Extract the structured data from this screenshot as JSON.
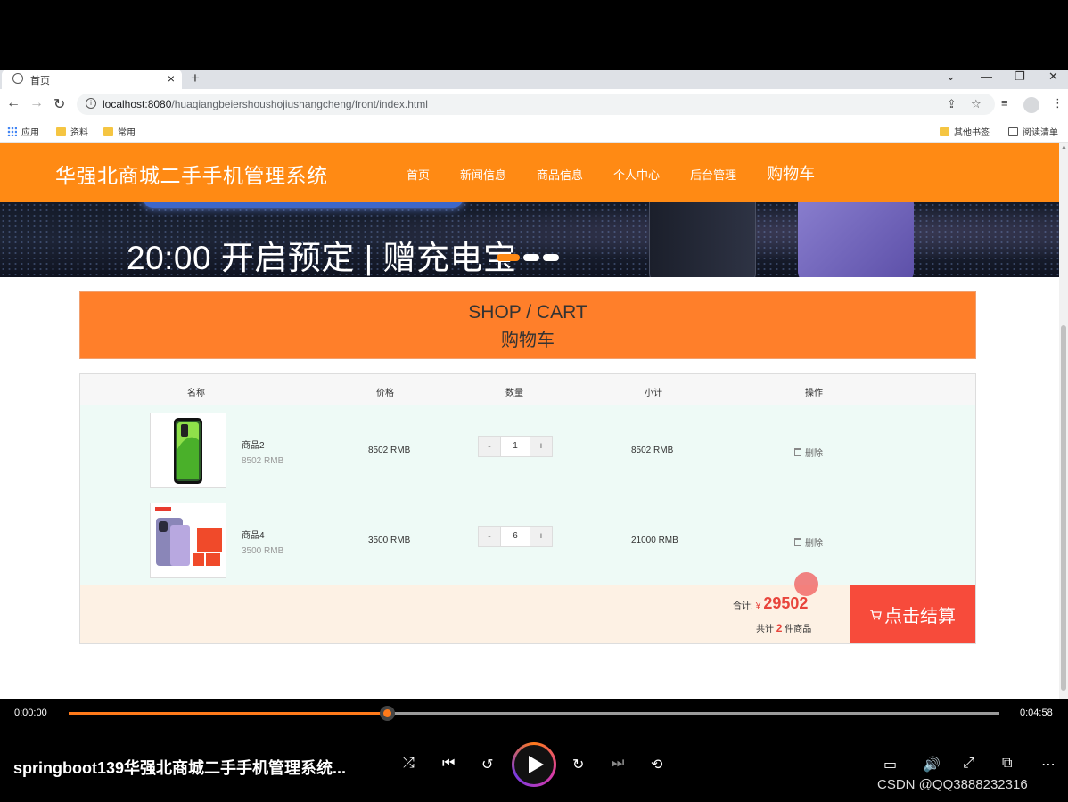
{
  "browser": {
    "tab_title": "首页",
    "url_host": "localhost:8080",
    "url_path": "/huaqiangbeiershoushojiushangcheng/front/index.html",
    "bookmarks": [
      "应用",
      "资料",
      "常用"
    ],
    "bookmarks_right": [
      "其他书签",
      "阅读清单"
    ]
  },
  "site": {
    "title": "华强北商城二手手机管理系统",
    "menu": [
      "首页",
      "新闻信息",
      "商品信息",
      "个人中心",
      "后台管理",
      "购物车"
    ],
    "banner_text": "20:00 开启预定 | 赠充电宝"
  },
  "cart": {
    "hero_en": "SHOP / CART",
    "hero_zh": "购物车",
    "headers": {
      "name": "名称",
      "price": "价格",
      "qty": "数量",
      "subtotal": "小计",
      "action": "操作"
    },
    "items": [
      {
        "name": "商品2",
        "unit": "8502 RMB",
        "price": "8502 RMB",
        "qty": "1",
        "subtotal": "8502 RMB",
        "delete": "删除"
      },
      {
        "name": "商品4",
        "unit": "3500 RMB",
        "price": "3500 RMB",
        "qty": "6",
        "subtotal": "21000 RMB",
        "delete": "删除"
      }
    ],
    "qty_minus": "-",
    "qty_plus": "+",
    "total_label": "合计:",
    "currency": "¥",
    "total": "29502",
    "count_prefix": "共计",
    "count": "2",
    "count_suffix": "件商品",
    "checkout": "点击结算"
  },
  "player": {
    "current_time": "0:00:00",
    "duration": "0:04:58",
    "progress": 0.342,
    "title": "springboot139华强北商城二手手机管理系统...",
    "watermark": "CSDN @QQ3888232316"
  },
  "colors": {
    "brand_orange": "#ff8a14",
    "hero_orange": "#ff7f2a",
    "checkout_red": "#f74b3b",
    "accent_orange": "#ff7a1a"
  }
}
